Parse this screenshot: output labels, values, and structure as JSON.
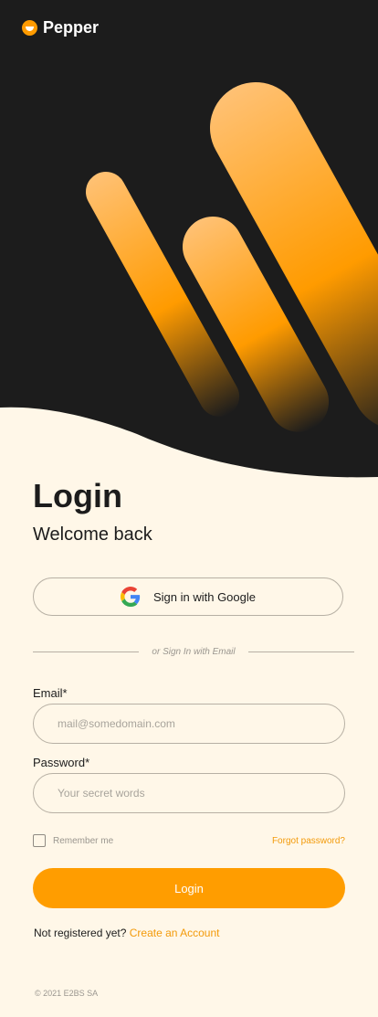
{
  "brand": {
    "name": "Pepper"
  },
  "login": {
    "title": "Login",
    "subtitle": "Welcome back",
    "google_button_label": "Sign in with Google",
    "divider_text": "or Sign In with Email",
    "email": {
      "label": "Email*",
      "placeholder": "mail@somedomain.com",
      "value": ""
    },
    "password": {
      "label": "Password*",
      "placeholder": "Your secret words",
      "value": ""
    },
    "remember_label": "Remember me",
    "remember_checked": false,
    "forgot_label": "Forgot password?",
    "submit_label": "Login",
    "register_prompt": "Not registered yet?",
    "register_link": "Create an Account"
  },
  "footer": {
    "copyright": "© 2021 E2BS SA"
  },
  "colors": {
    "accent": "#ff9d00",
    "link": "#f39a09",
    "hero_background": "#1c1c1c",
    "page_background": "#fff7e8"
  },
  "icons": [
    "brand-logo-icon",
    "google-icon"
  ]
}
